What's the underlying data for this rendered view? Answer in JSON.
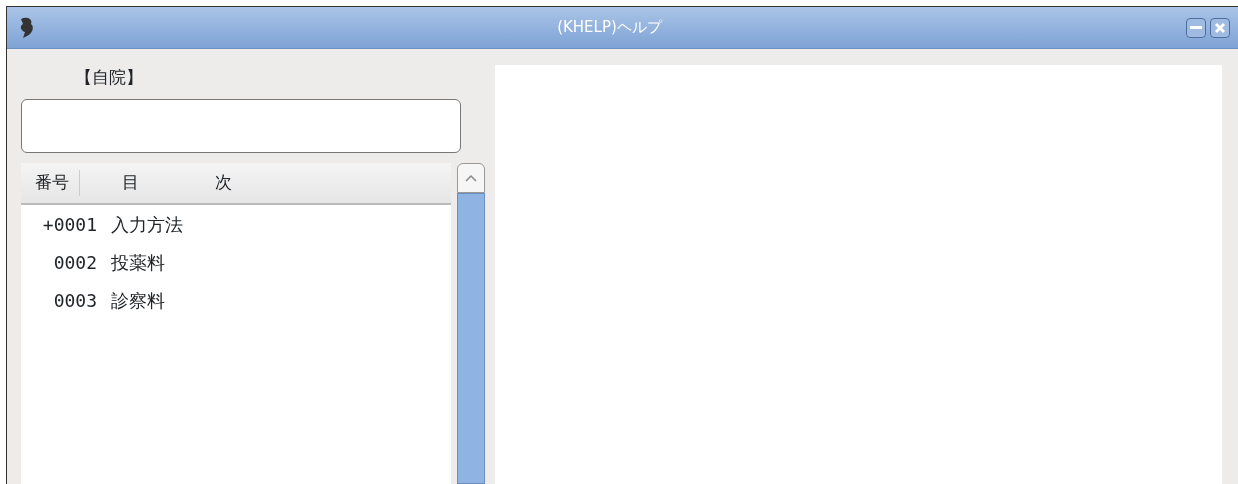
{
  "window": {
    "title": "(KHELP)ヘルプ"
  },
  "clinic_label": "【自院】",
  "list": {
    "columns": [
      "番号",
      "目",
      "次"
    ],
    "rows": [
      {
        "number": "+0001",
        "title": "入力方法"
      },
      {
        "number": "0002",
        "title": "投薬料"
      },
      {
        "number": "0003",
        "title": "診察料"
      }
    ]
  }
}
